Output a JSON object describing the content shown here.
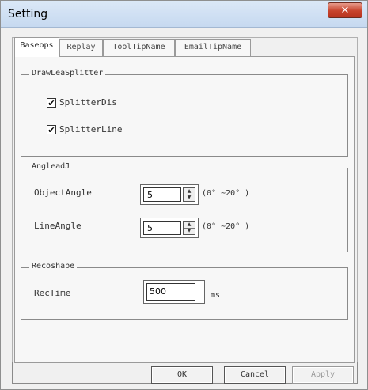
{
  "window": {
    "title": "Setting",
    "close_glyph": "✕"
  },
  "tabs": [
    {
      "label": "Baseops",
      "active": true
    },
    {
      "label": "Replay",
      "active": false
    },
    {
      "label": "ToolTipName",
      "active": false
    },
    {
      "label": "EmailTipName",
      "active": false
    }
  ],
  "groups": {
    "draw_splitter": {
      "title": "DrawLeaSplitter",
      "options": [
        {
          "label": "SplitterDis",
          "checked": true
        },
        {
          "label": "SplitterLine",
          "checked": true
        }
      ]
    },
    "angle": {
      "title": "AngleadJ",
      "fields": [
        {
          "label": "ObjectAngle",
          "value": "5",
          "range": "(0° ~20° )"
        },
        {
          "label": "LineAngle",
          "value": "5",
          "range": "(0° ~20° )"
        }
      ]
    },
    "recoshape": {
      "title": "Recoshape",
      "field": {
        "label": "RecTime",
        "value": "500",
        "unit": "ms"
      }
    }
  },
  "buttons": {
    "ok": {
      "label": "OK",
      "enabled": true
    },
    "cancel": {
      "label": "Cancel",
      "enabled": true
    },
    "apply": {
      "label": "Apply",
      "enabled": false
    }
  },
  "icons": {
    "check": "✔",
    "spin_up": "▲",
    "spin_down": "▼"
  }
}
